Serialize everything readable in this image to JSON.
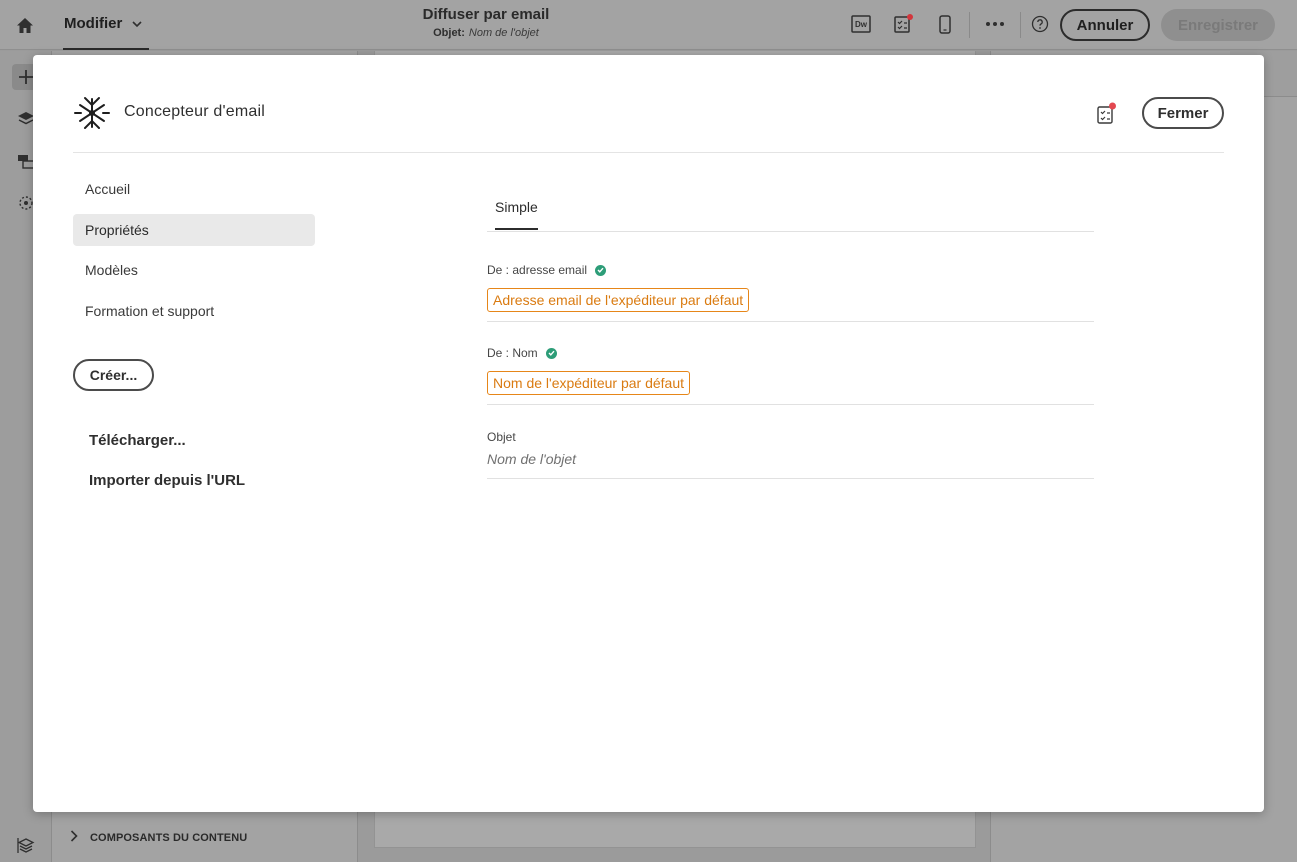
{
  "app": {
    "mode_menu_label": "Modifier",
    "doc_title": "Diffuser par email",
    "doc_subject_label": "Objet:",
    "doc_subject_value": "Nom de l'objet",
    "dw_label": "Dw",
    "cancel_label": "Annuler",
    "save_label": "Enregistrer",
    "components_label": "COMPOSANTS DU CONTENU"
  },
  "modal": {
    "title": "Concepteur d'email",
    "close_label": "Fermer",
    "nav": [
      {
        "label": "Accueil"
      },
      {
        "label": "Propriétés"
      },
      {
        "label": "Modèles"
      },
      {
        "label": "Formation et support"
      }
    ],
    "selected_nav": "Propriétés",
    "create_label": "Créer...",
    "upload_label": "Télécharger...",
    "import_label": "Importer depuis l'URL",
    "tab_label": "Simple",
    "fields": {
      "from_email": {
        "label": "De : adresse email",
        "value": "Adresse email de l'expéditeur par défaut",
        "validated": true
      },
      "from_name": {
        "label": "De : Nom",
        "value": "Nom de l'expéditeur par défaut",
        "validated": true
      },
      "subject": {
        "label": "Objet",
        "placeholder": "Nom de l'objet"
      }
    }
  },
  "colors": {
    "accent_orange": "#e68619",
    "success_green": "#2d9d78",
    "notification_red": "#e34850",
    "overlay_gray": "#9b9b9b"
  },
  "icons": [
    "home-icon",
    "chevron-down-icon",
    "dreamweaver-icon",
    "checklist-icon",
    "mobile-icon",
    "more-icon",
    "help-icon",
    "add-icon",
    "layers-icon",
    "fragments-icon",
    "assets-icon",
    "content-components-icon",
    "chevron-right-icon",
    "designer-logo-icon",
    "checkmark-icon"
  ]
}
